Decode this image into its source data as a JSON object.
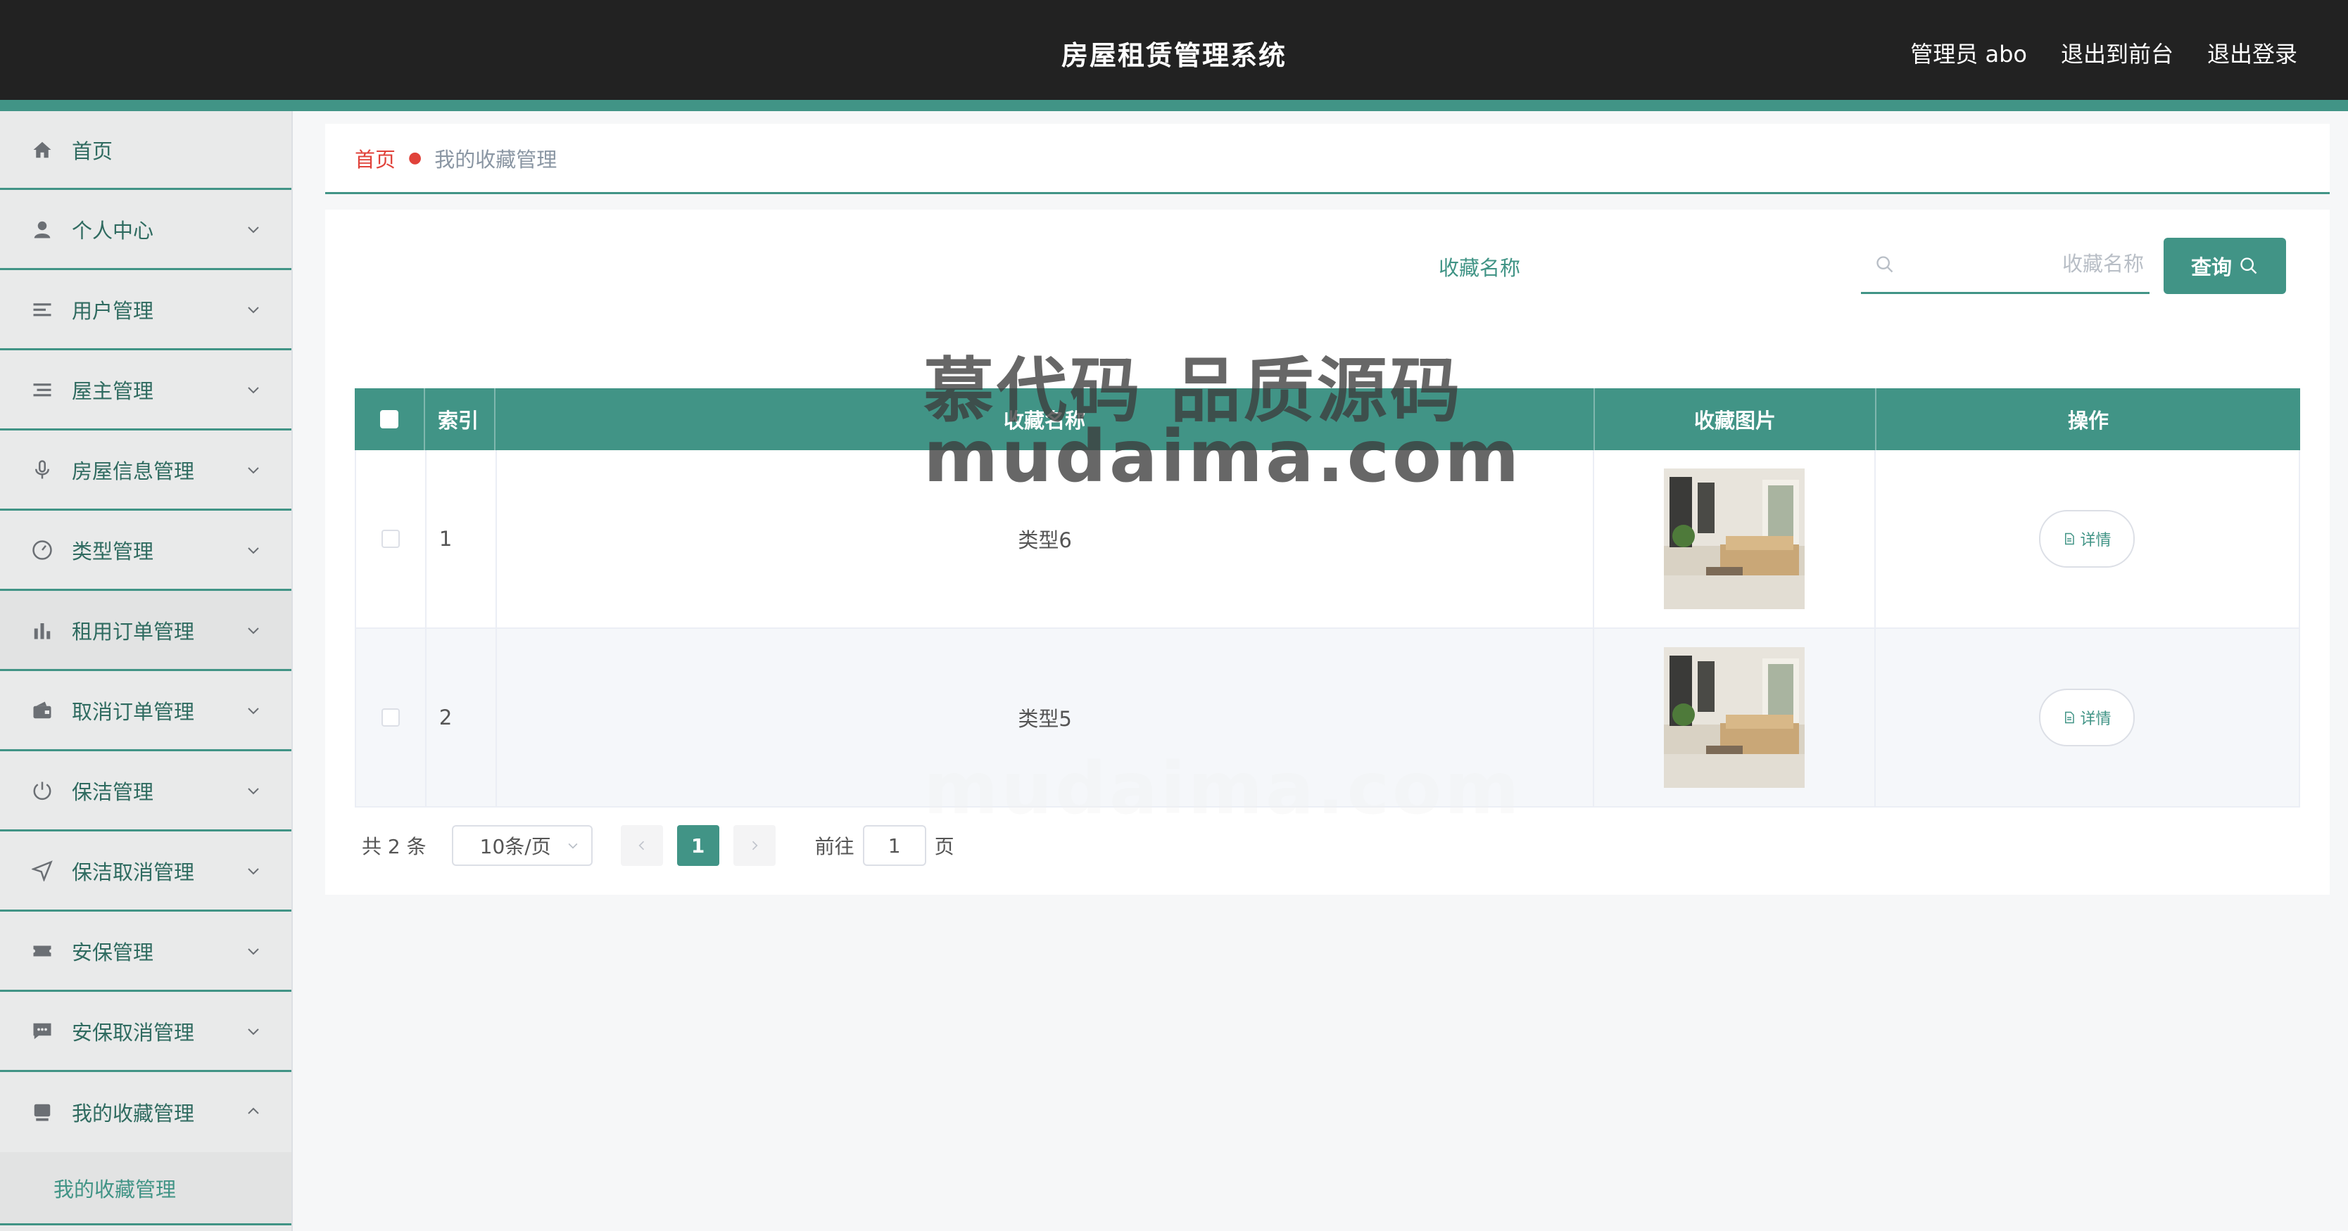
{
  "header": {
    "title": "房屋租赁管理系统",
    "user": "管理员 abo",
    "to_front": "退出到前台",
    "logout": "退出登录"
  },
  "sidebar": {
    "items": [
      {
        "label": "首页",
        "icon": "home-icon"
      },
      {
        "label": "个人中心",
        "icon": "user-icon"
      },
      {
        "label": "用户管理",
        "icon": "list-icon"
      },
      {
        "label": "屋主管理",
        "icon": "list-icon"
      },
      {
        "label": "房屋信息管理",
        "icon": "microphone-icon"
      },
      {
        "label": "类型管理",
        "icon": "gauge-icon"
      },
      {
        "label": "租用订单管理",
        "icon": "bar-chart-icon"
      },
      {
        "label": "取消订单管理",
        "icon": "wallet-icon"
      },
      {
        "label": "保洁管理",
        "icon": "power-icon"
      },
      {
        "label": "保洁取消管理",
        "icon": "send-icon"
      },
      {
        "label": "安保管理",
        "icon": "ticket-icon"
      },
      {
        "label": "安保取消管理",
        "icon": "chat-icon"
      },
      {
        "label": "我的收藏管理",
        "icon": "inbox-icon"
      }
    ],
    "sub_item": "我的收藏管理"
  },
  "breadcrumb": {
    "home": "首页",
    "current": "我的收藏管理"
  },
  "search": {
    "label": "收藏名称",
    "placeholder": "收藏名称",
    "value": "",
    "button": "查询"
  },
  "table": {
    "headers": {
      "index": "索引",
      "name": "收藏名称",
      "image": "收藏图片",
      "ops": "操作"
    },
    "rows": [
      {
        "index": "1",
        "name": "类型6",
        "detail": "详情"
      },
      {
        "index": "2",
        "name": "类型5",
        "detail": "详情"
      }
    ]
  },
  "pagination": {
    "total": "共 2 条",
    "page_size": "10条/页",
    "current_page": "1",
    "goto_label": "前往",
    "goto_value": "1",
    "page_unit": "页"
  },
  "watermark": {
    "line1": "慕代码 品质源码",
    "line2": "mudaima.com"
  },
  "colors": {
    "accent": "#419486",
    "topbar": "#222222",
    "breadcrumb_home": "#e0423a"
  }
}
